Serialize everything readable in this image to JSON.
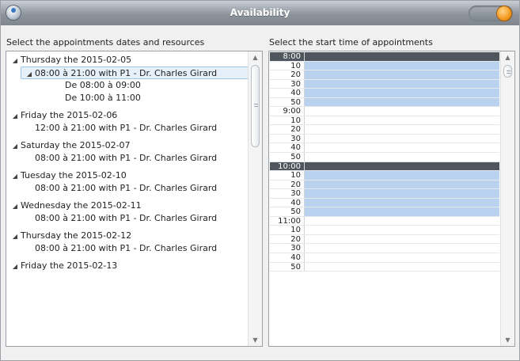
{
  "window": {
    "title": "Availability"
  },
  "left": {
    "label": "Select the appointments dates and resources",
    "days": [
      {
        "day": "Thursday the 2015-02-05",
        "slot": "08:00 à 21:00 with P1 - Dr. Charles Girard",
        "expanded": true,
        "sub": [
          "De 08:00 à 09:00",
          "De 10:00 à 11:00"
        ]
      },
      {
        "day": "Friday the 2015-02-06",
        "slot": "12:00 à 21:00 with P1 - Dr. Charles Girard"
      },
      {
        "day": "Saturday the 2015-02-07",
        "slot": "08:00 à 21:00 with P1 - Dr. Charles Girard"
      },
      {
        "day": "Tuesday the 2015-02-10",
        "slot": "08:00 à 21:00 with P1 - Dr. Charles Girard"
      },
      {
        "day": "Wednesday the 2015-02-11",
        "slot": "08:00 à 21:00 with P1 - Dr. Charles Girard"
      },
      {
        "day": "Thursday the 2015-02-12",
        "slot": "08:00 à 21:00 with P1 - Dr. Charles Girard"
      },
      {
        "day": "Friday the 2015-02-13"
      }
    ]
  },
  "right": {
    "label": "Select the start time of appointments",
    "times": [
      {
        "t": "8:00",
        "kind": "hour-dark"
      },
      {
        "t": "10",
        "kind": "avail"
      },
      {
        "t": "20",
        "kind": "avail"
      },
      {
        "t": "30",
        "kind": "avail"
      },
      {
        "t": "40",
        "kind": "avail"
      },
      {
        "t": "50",
        "kind": "avail"
      },
      {
        "t": "9:00",
        "kind": "hour"
      },
      {
        "t": "10",
        "kind": ""
      },
      {
        "t": "20",
        "kind": ""
      },
      {
        "t": "30",
        "kind": ""
      },
      {
        "t": "40",
        "kind": ""
      },
      {
        "t": "50",
        "kind": ""
      },
      {
        "t": "10:00",
        "kind": "hour-dark"
      },
      {
        "t": "10",
        "kind": "avail"
      },
      {
        "t": "20",
        "kind": "avail"
      },
      {
        "t": "30",
        "kind": "avail"
      },
      {
        "t": "40",
        "kind": "avail"
      },
      {
        "t": "50",
        "kind": "avail"
      },
      {
        "t": "11:00",
        "kind": "hour"
      },
      {
        "t": "10",
        "kind": ""
      },
      {
        "t": "20",
        "kind": ""
      },
      {
        "t": "30",
        "kind": ""
      },
      {
        "t": "40",
        "kind": ""
      },
      {
        "t": "50",
        "kind": ""
      }
    ]
  }
}
